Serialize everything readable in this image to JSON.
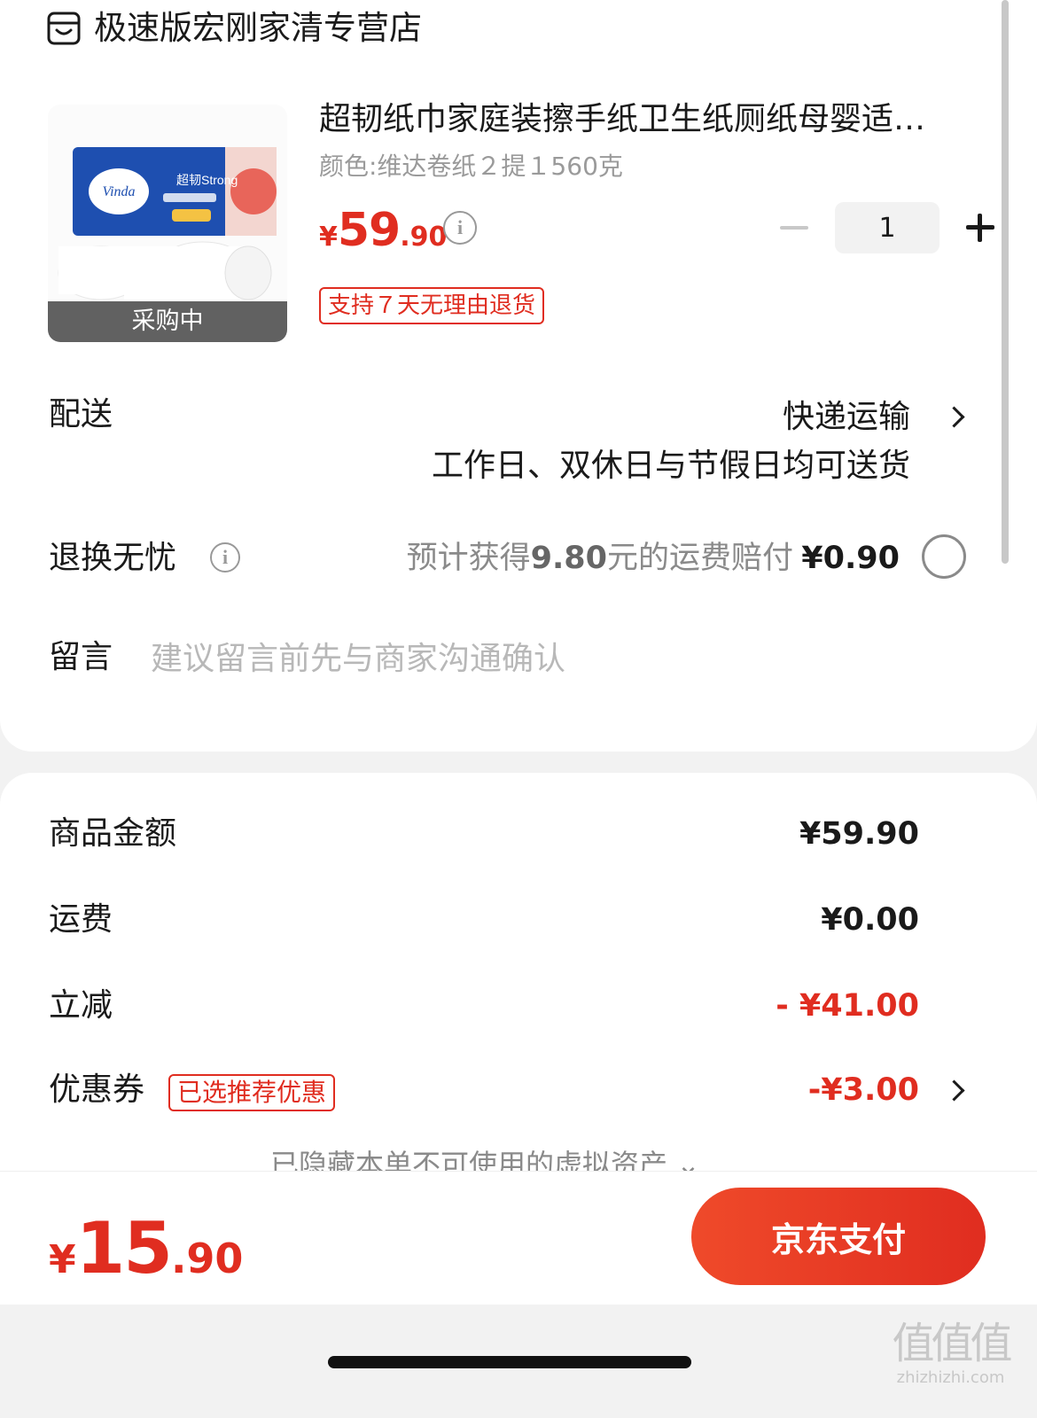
{
  "store": {
    "name": "极速版宏刚家清专营店",
    "icon": "store-icon"
  },
  "product": {
    "title": "超韧纸巾家庭装擦手纸卫生纸厕纸母婴适…",
    "spec": "颜色:维达卷纸２提１560克",
    "price": {
      "currency": "¥",
      "integer": "59",
      "decimal": ".90"
    },
    "quantity": "1",
    "tag": "支持７天无理由退货",
    "image_overlay": "采购中",
    "image_brand_text": "Vinda",
    "image_subtitle": "超韧Strong"
  },
  "delivery": {
    "label": "配送",
    "method": "快递运输",
    "note": "工作日、双休日与节假日均可送货"
  },
  "return_insurance": {
    "label": "退换无忧",
    "desc_prefix": "预计获得",
    "desc_amount": "9.80",
    "desc_suffix": "元的运费赔付",
    "price": "¥0.90"
  },
  "message": {
    "label": "留言",
    "placeholder": "建议留言前先与商家沟通确认"
  },
  "summary": {
    "goods_label": "商品金额",
    "goods_value": "¥59.90",
    "shipping_label": "运费",
    "shipping_value": "¥0.00",
    "discount_label": "立减",
    "discount_value": "- ¥41.00",
    "coupon_label": "优惠券",
    "coupon_tag": "已选推荐优惠",
    "coupon_value": "-¥3.00",
    "hidden_assets": "已隐藏本单不可使用的虚拟资产 ⌄"
  },
  "footer": {
    "total": {
      "currency": "¥",
      "integer": "15",
      "decimal": ".90"
    },
    "pay_button": "京东支付"
  },
  "watermark": {
    "big": "值值值",
    "small": "zhizhizhi.com"
  },
  "colors": {
    "accent": "#e02d20",
    "muted": "#9a9a9a"
  }
}
